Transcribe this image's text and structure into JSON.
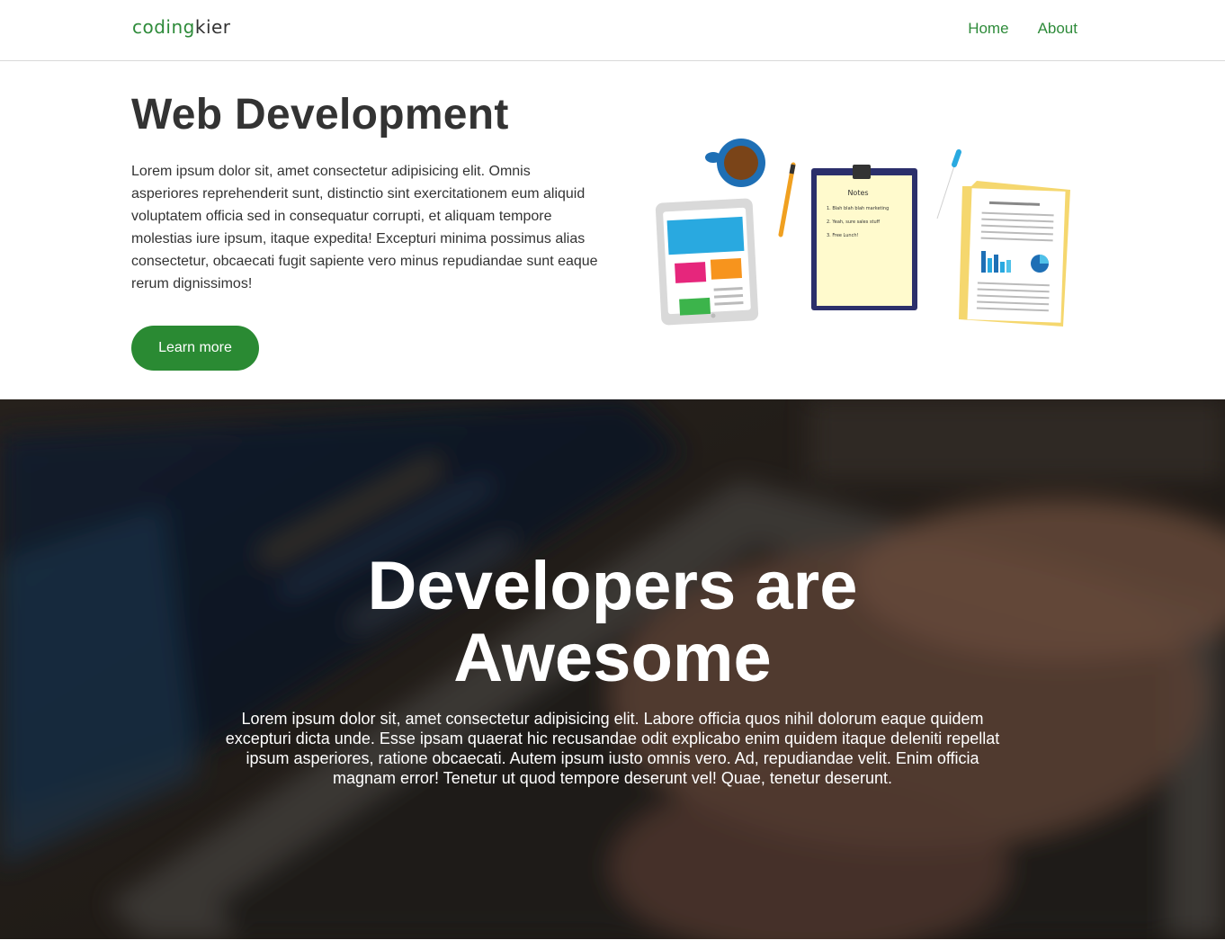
{
  "header": {
    "logo_part1": "coding",
    "logo_part2": "kier",
    "nav": [
      {
        "label": "Home"
      },
      {
        "label": "About"
      }
    ]
  },
  "hero": {
    "title": "Web Development",
    "text": "Lorem ipsum dolor sit, amet consectetur adipisicing elit. Omnis asperiores reprehenderit sunt, distinctio sint exercitationem eum aliquid voluptatem officia sed in consequatur corrupti, et aliquam tempore molestias iure ipsum, itaque expedita! Excepturi minima possimus alias consectetur, obcaecati fugit sapiente vero minus repudiandae sunt eaque rerum dignissimos!",
    "button_label": "Learn more",
    "illustration": {
      "notes_title": "Notes",
      "notes_items": [
        "1. Blah blah blah marketing",
        "2. Yeah, sure sales stuff",
        "3. Free Lunch!"
      ]
    }
  },
  "banner": {
    "title_line1": "Developers are",
    "title_line2": "Awesome",
    "text": "Lorem ipsum dolor sit, amet consectetur adipisicing elit. Labore officia quos nihil dolorum eaque quidem excepturi dicta unde. Esse ipsam quaerat hic recusandae odit explicabo enim quidem itaque deleniti repellat ipsum asperiores, ratione obcaecati. Autem ipsum iusto omnis vero. Ad, repudiandae velit. Enim officia magnam error! Tenetur ut quod tempore deserunt vel! Quae, tenetur deserunt."
  },
  "colors": {
    "brand_green": "#2a8a33",
    "text_dark": "#333333"
  }
}
